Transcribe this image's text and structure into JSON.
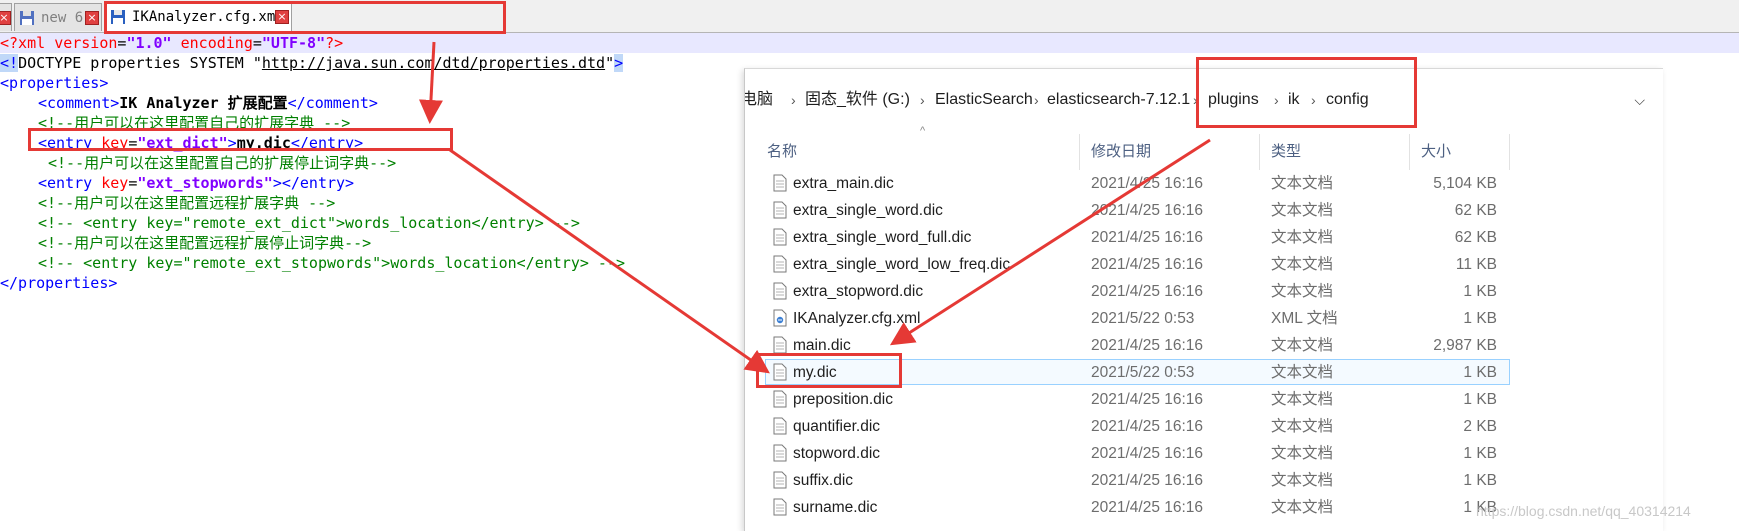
{
  "editor": {
    "tabs": [
      {
        "label": "new 6"
      },
      {
        "label": "IKAnalyzer.cfg.xml"
      }
    ],
    "lines": {
      "l1": {
        "open": "<?xml ",
        "k1": "version",
        "eq1": "=",
        "v1": "\"1.0\"",
        "sp": " ",
        "k2": "encoding",
        "eq2": "=",
        "v2": "\"UTF-8\"",
        "close": "?>"
      },
      "l2": {
        "a": "<!",
        "b": "DOCTYPE properties SYSTEM \"",
        "url": "http://java.sun.com/dtd/properties.dtd",
        "c": "\"",
        "d": ">"
      },
      "l3": {
        "tag": "<properties>"
      },
      "l4": {
        "open": "<comment>",
        "text": "IK Analyzer 扩展配置",
        "close": "</comment>"
      },
      "l5": {
        "text": "<!--用户可以在这里配置自己的扩展字典 -->"
      },
      "l6": {
        "open": "<entry ",
        "key": "key",
        "eq": "=",
        "val": "\"ext_dict\"",
        "gt": ">",
        "text": "my.dic",
        "close": "</entry>"
      },
      "l7": {
        "text": "<!--用户可以在这里配置自己的扩展停止词字典-->"
      },
      "l8": {
        "open": "<entry ",
        "key": "key",
        "eq": "=",
        "val": "\"ext_stopwords\"",
        "gt": ">",
        "close": "</entry>"
      },
      "l9": {
        "text": "<!--用户可以在这里配置远程扩展字典 -->"
      },
      "l10": {
        "text": "<!-- <entry key=\"remote_ext_dict\">words_location</entry> -->"
      },
      "l11": {
        "text": "<!--用户可以在这里配置远程扩展停止词字典-->"
      },
      "l12": {
        "text": "<!-- <entry key=\"remote_ext_stopwords\">words_location</entry> -->"
      },
      "l13": {
        "tag": "</properties>"
      }
    }
  },
  "explorer": {
    "breadcrumb": [
      "电脑",
      "固态_软件 (G:)",
      "ElasticSearch",
      "elasticsearch-7.12.1",
      "plugins",
      "ik",
      "config"
    ],
    "columns": {
      "name": "名称",
      "date": "修改日期",
      "type": "类型",
      "size": "大小"
    },
    "files": [
      {
        "name": "extra_main.dic",
        "date": "2021/4/25 16:16",
        "type": "文本文档",
        "size": "5,104 KB"
      },
      {
        "name": "extra_single_word.dic",
        "date": "2021/4/25 16:16",
        "type": "文本文档",
        "size": "62 KB"
      },
      {
        "name": "extra_single_word_full.dic",
        "date": "2021/4/25 16:16",
        "type": "文本文档",
        "size": "62 KB"
      },
      {
        "name": "extra_single_word_low_freq.dic",
        "date": "2021/4/25 16:16",
        "type": "文本文档",
        "size": "11 KB"
      },
      {
        "name": "extra_stopword.dic",
        "date": "2021/4/25 16:16",
        "type": "文本文档",
        "size": "1 KB"
      },
      {
        "name": "IKAnalyzer.cfg.xml",
        "date": "2021/5/22 0:53",
        "type": "XML 文档",
        "size": "1 KB"
      },
      {
        "name": "main.dic",
        "date": "2021/4/25 16:16",
        "type": "文本文档",
        "size": "2,987 KB"
      },
      {
        "name": "my.dic",
        "date": "2021/5/22 0:53",
        "type": "文本文档",
        "size": "1 KB"
      },
      {
        "name": "preposition.dic",
        "date": "2021/4/25 16:16",
        "type": "文本文档",
        "size": "1 KB"
      },
      {
        "name": "quantifier.dic",
        "date": "2021/4/25 16:16",
        "type": "文本文档",
        "size": "2 KB"
      },
      {
        "name": "stopword.dic",
        "date": "2021/4/25 16:16",
        "type": "文本文档",
        "size": "1 KB"
      },
      {
        "name": "suffix.dic",
        "date": "2021/4/25 16:16",
        "type": "文本文档",
        "size": "1 KB"
      },
      {
        "name": "surname.dic",
        "date": "2021/4/25 16:16",
        "type": "文本文档",
        "size": "1 KB"
      }
    ]
  },
  "watermark": "https://blog.csdn.net/qq_40314214",
  "colors": {
    "annotation": "#e53935",
    "xml_tag": "#0000ff",
    "xml_attr": "#ff0000",
    "xml_value": "#8000ff",
    "xml_comment": "#008000"
  }
}
